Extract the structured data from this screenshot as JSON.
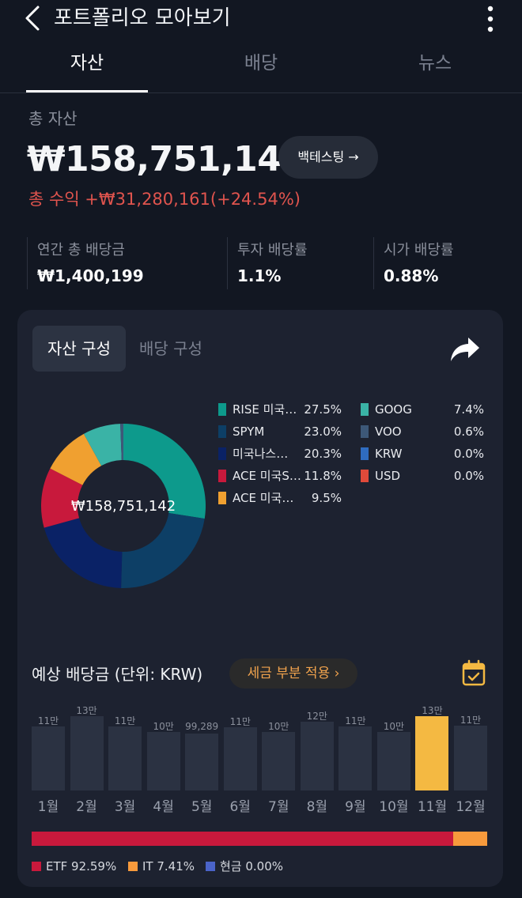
{
  "header": {
    "title": "포트폴리오 모아보기"
  },
  "tabs": [
    {
      "label": "자산"
    },
    {
      "label": "배당"
    },
    {
      "label": "뉴스"
    }
  ],
  "summary": {
    "total_label": "총 자산",
    "total_value": "₩158,751,142",
    "backtest_label": "백테스팅 →",
    "profit_text": "총 수익 +₩31,280,161(+24.54%)"
  },
  "stats": [
    {
      "label": "연간 총 배당금",
      "value": "₩1,400,199"
    },
    {
      "label": "투자 배당률",
      "value": "1.1%"
    },
    {
      "label": "시가 배당률",
      "value": "0.88%"
    }
  ],
  "composition": {
    "tab_active": "자산 구성",
    "tab_inactive": "배당 구성",
    "center_value": "₩158,751,142"
  },
  "dividend": {
    "title": "예상 배당금 (단위: KRW)",
    "tax_label": "세금 부분 적용 ›"
  },
  "alloc_legend": [
    {
      "label": "ETF 92.59%",
      "color": "#c8193c"
    },
    {
      "label": "IT 7.41%",
      "color": "#f79a3c"
    },
    {
      "label": "현금 0.00%",
      "color": "#4a63c8"
    }
  ],
  "chart_data": [
    {
      "type": "pie",
      "style": "donut",
      "slices": [
        {
          "label": "RISE 미국…",
          "pct_label": "27.5%",
          "value": 27.5,
          "color": "#0d9a8c"
        },
        {
          "label": "SPYM",
          "pct_label": "23.0%",
          "value": 23.0,
          "color": "#0d3f66"
        },
        {
          "label": "미국나스…",
          "pct_label": "20.3%",
          "value": 20.3,
          "color": "#0a2266"
        },
        {
          "label": "ACE 미국S…",
          "pct_label": "11.8%",
          "value": 11.8,
          "color": "#c8193c"
        },
        {
          "label": "ACE 미국…",
          "pct_label": "9.5%",
          "value": 9.5,
          "color": "#f0a030"
        },
        {
          "label": "GOOG",
          "pct_label": "7.4%",
          "value": 7.4,
          "color": "#3ab3a6"
        },
        {
          "label": "VOO",
          "pct_label": "0.6%",
          "value": 0.6,
          "color": "#3d5878"
        },
        {
          "label": "KRW",
          "pct_label": "0.0%",
          "value": 0.0,
          "color": "#2f6cc0"
        },
        {
          "label": "USD",
          "pct_label": "0.0%",
          "value": 0.0,
          "color": "#e04a3a"
        }
      ]
    },
    {
      "type": "bar",
      "categories": [
        "1월",
        "2월",
        "3월",
        "4월",
        "5월",
        "6월",
        "7월",
        "8월",
        "9월",
        "10월",
        "11월",
        "12월"
      ],
      "labels": [
        "11만",
        "13만",
        "11만",
        "10만",
        "99,289",
        "11만",
        "10만",
        "12만",
        "11만",
        "10만",
        "13만",
        "11만"
      ],
      "values": [
        112000,
        130000,
        112000,
        102000,
        99289,
        111000,
        102000,
        120000,
        112000,
        102000,
        130000,
        114000
      ],
      "highlight_index": 10,
      "ylim": [
        0,
        130000
      ]
    },
    {
      "type": "bar",
      "style": "stacked-horizontal",
      "segments": [
        {
          "name": "ETF",
          "value": 92.59,
          "color": "#c8193c"
        },
        {
          "name": "IT",
          "value": 7.41,
          "color": "#f79a3c"
        },
        {
          "name": "현금",
          "value": 0.0,
          "color": "#4a63c8"
        }
      ]
    }
  ]
}
